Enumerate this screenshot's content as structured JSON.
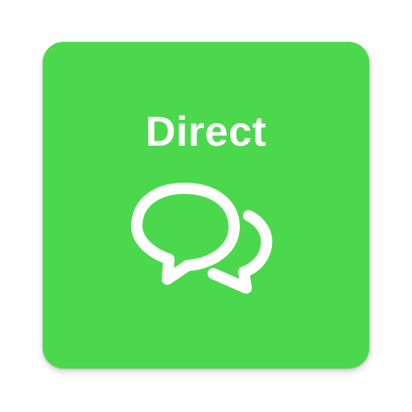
{
  "app": {
    "name": "Direct",
    "icon": "chat-bubbles-icon"
  },
  "colors": {
    "background": "#4CD84C",
    "foreground": "#ffffff"
  }
}
